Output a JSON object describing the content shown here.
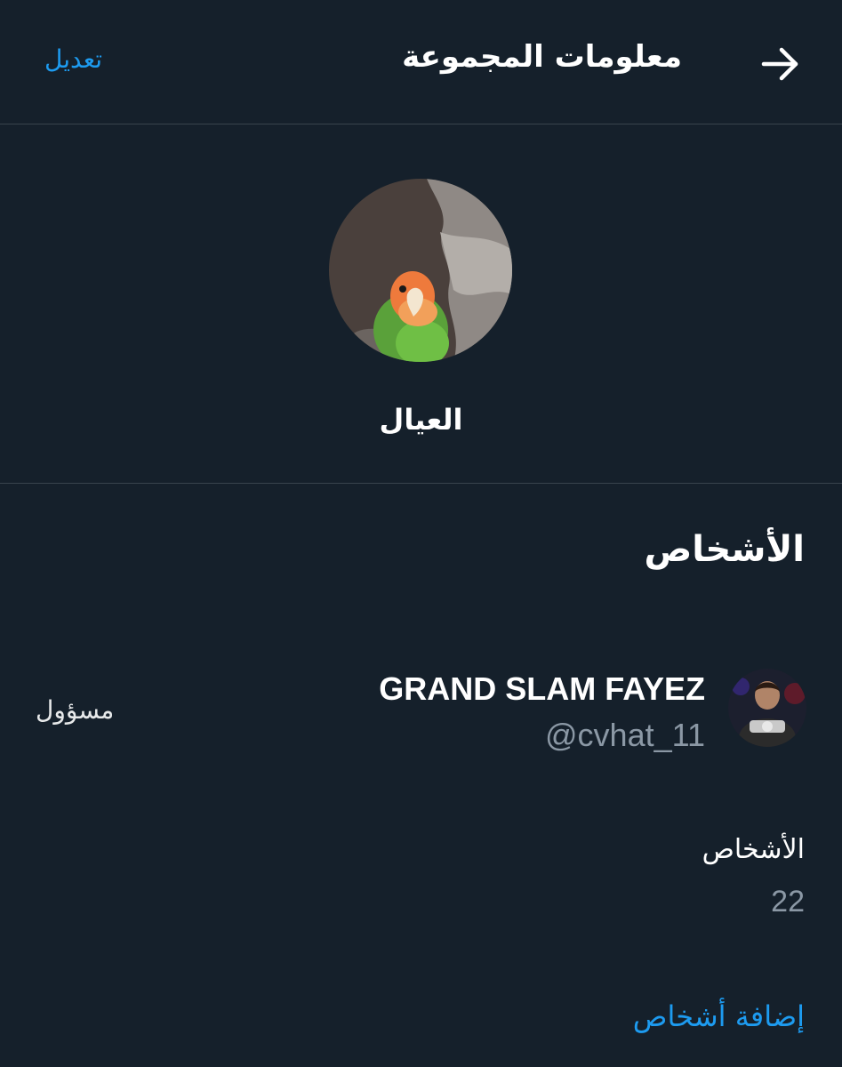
{
  "header": {
    "title": "معلومات المجموعة",
    "edit_label": "تعديل",
    "accent_color": "#1d9bf0"
  },
  "group": {
    "name": "العيال",
    "avatar_icon": "parrot-photo"
  },
  "people_section": {
    "heading": "الأشخاص",
    "members": [
      {
        "display_name": "GRAND SLAM FAYEZ",
        "handle": "@cvhat_11",
        "role": "مسؤول",
        "avatar_icon": "user-photo"
      }
    ],
    "count_label": "الأشخاص",
    "count_value": "22",
    "add_label": "إضافة أشخاص"
  },
  "colors": {
    "background": "#15202b",
    "divider": "#38444d",
    "secondary_text": "#8b98a5"
  }
}
